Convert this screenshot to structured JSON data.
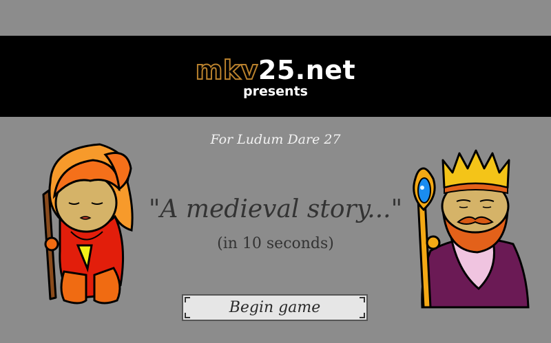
{
  "header": {
    "logo_prefix": "mkv",
    "logo_suffix": "25.net",
    "presents": "presents"
  },
  "intro": {
    "event": "For Ludum Dare 27",
    "title": "\"A medieval story...\"",
    "subtitle": "(in 10 seconds)"
  },
  "menu": {
    "begin_label": "Begin game"
  },
  "characters": {
    "left": "queen-character",
    "right": "king-character"
  },
  "colors": {
    "background": "#8c8c8c",
    "banner": "#000000",
    "logo_accent": "#b9812d"
  }
}
